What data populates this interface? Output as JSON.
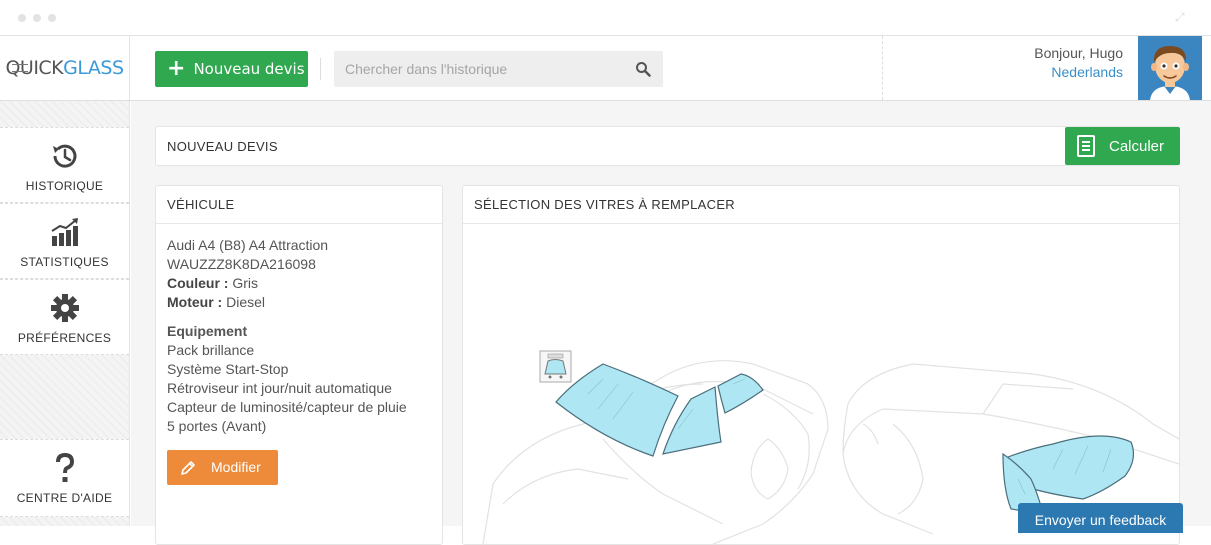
{
  "app": {
    "logo_prefix": "QUICK",
    "logo_suffix": "GLASS"
  },
  "topbar": {
    "new_quote_label": "Nouveau devis",
    "search_placeholder": "Chercher dans l'historique",
    "greeting": "Bonjour, Hugo",
    "language": "Nederlands"
  },
  "sidebar": {
    "items": [
      {
        "label": "HISTORIQUE",
        "icon": "history-icon"
      },
      {
        "label": "STATISTIQUES",
        "icon": "chart-icon"
      },
      {
        "label": "PRÉFÉRENCES",
        "icon": "gear-icon"
      },
      {
        "label": "CENTRE D'AIDE",
        "icon": "question-icon"
      }
    ]
  },
  "main": {
    "title": "NOUVEAU DEVIS",
    "calculate_label": "Calculer"
  },
  "vehicle": {
    "heading": "VÉHICULE",
    "model": "Audi A4 (B8) A4 Attraction",
    "vin": "WAUZZZ8K8DA216098",
    "color_label": "Couleur :",
    "color_value": "Gris",
    "engine_label": "Moteur :",
    "engine_value": "Diesel",
    "equipment_title": "Equipement",
    "equipment": [
      "Pack brillance",
      "Système Start-Stop",
      "Rétroviseur int jour/nuit automatique",
      "Capteur de luminosité/capteur de pluie",
      "5 portes (Avant)"
    ],
    "modify_label": "Modifier"
  },
  "selection": {
    "heading": "SÉLECTION DES VITRES À REMPLACER"
  },
  "feedback_label": "Envoyer un feedback",
  "colors": {
    "green": "#2fa84f",
    "orange": "#ee8b3a",
    "blue": "#2c78b1",
    "glass": "#aee6f4"
  }
}
